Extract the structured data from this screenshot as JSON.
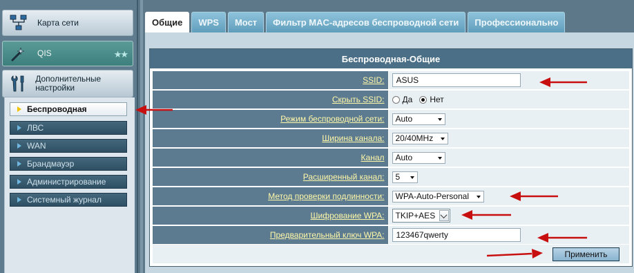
{
  "sidebar": {
    "network_map": "Карта сети",
    "qis": "QIS",
    "qis_stars": "★★",
    "advanced": "Дополнительные настройки",
    "items": [
      {
        "label": "Беспроводная",
        "active": true
      },
      {
        "label": "ЛВС"
      },
      {
        "label": "WAN"
      },
      {
        "label": "Брандмауэр"
      },
      {
        "label": "Администрирование"
      },
      {
        "label": "Системный журнал"
      }
    ]
  },
  "tabs": [
    {
      "label": "Общие",
      "active": true
    },
    {
      "label": "WPS"
    },
    {
      "label": "Мост"
    },
    {
      "label": "Фильтр MAC-адресов беспроводной сети"
    },
    {
      "label": "Профессионально"
    }
  ],
  "panel": {
    "title": "Беспроводная-Общие",
    "ssid_label": "SSID:",
    "ssid_value": "ASUS",
    "hide_ssid_label": "Скрыть SSID:",
    "hide_yes": "Да",
    "hide_no": "Нет",
    "mode_label": "Режим беспроводной сети:",
    "mode_value": "Auto",
    "bw_label": "Ширина канала:",
    "bw_value": "20/40MHz",
    "channel_label": "Канал",
    "channel_value": "Auto",
    "ext_channel_label": "Расширенный канал:",
    "ext_channel_value": "5",
    "auth_label": "Метод проверки подлинности:",
    "auth_value": "WPA-Auto-Personal",
    "enc_label": "Шифрование WPA:",
    "enc_value": "TKIP+AES",
    "psk_label": "Предварительный ключ WPA:",
    "psk_value": "123467qwerty",
    "apply": "Применить"
  },
  "colors": {
    "annotation_arrow": "#c80f0f",
    "label_text": "#fff8a8",
    "label_bg": "#5d7b90",
    "value_bg": "#e9f0f4",
    "panel_header": "#4a6f86"
  },
  "icons": [
    "network-map-icon",
    "wizard-wand-icon",
    "tools-icon",
    "triangle-bullet-icon",
    "annotation-arrow-icon"
  ]
}
